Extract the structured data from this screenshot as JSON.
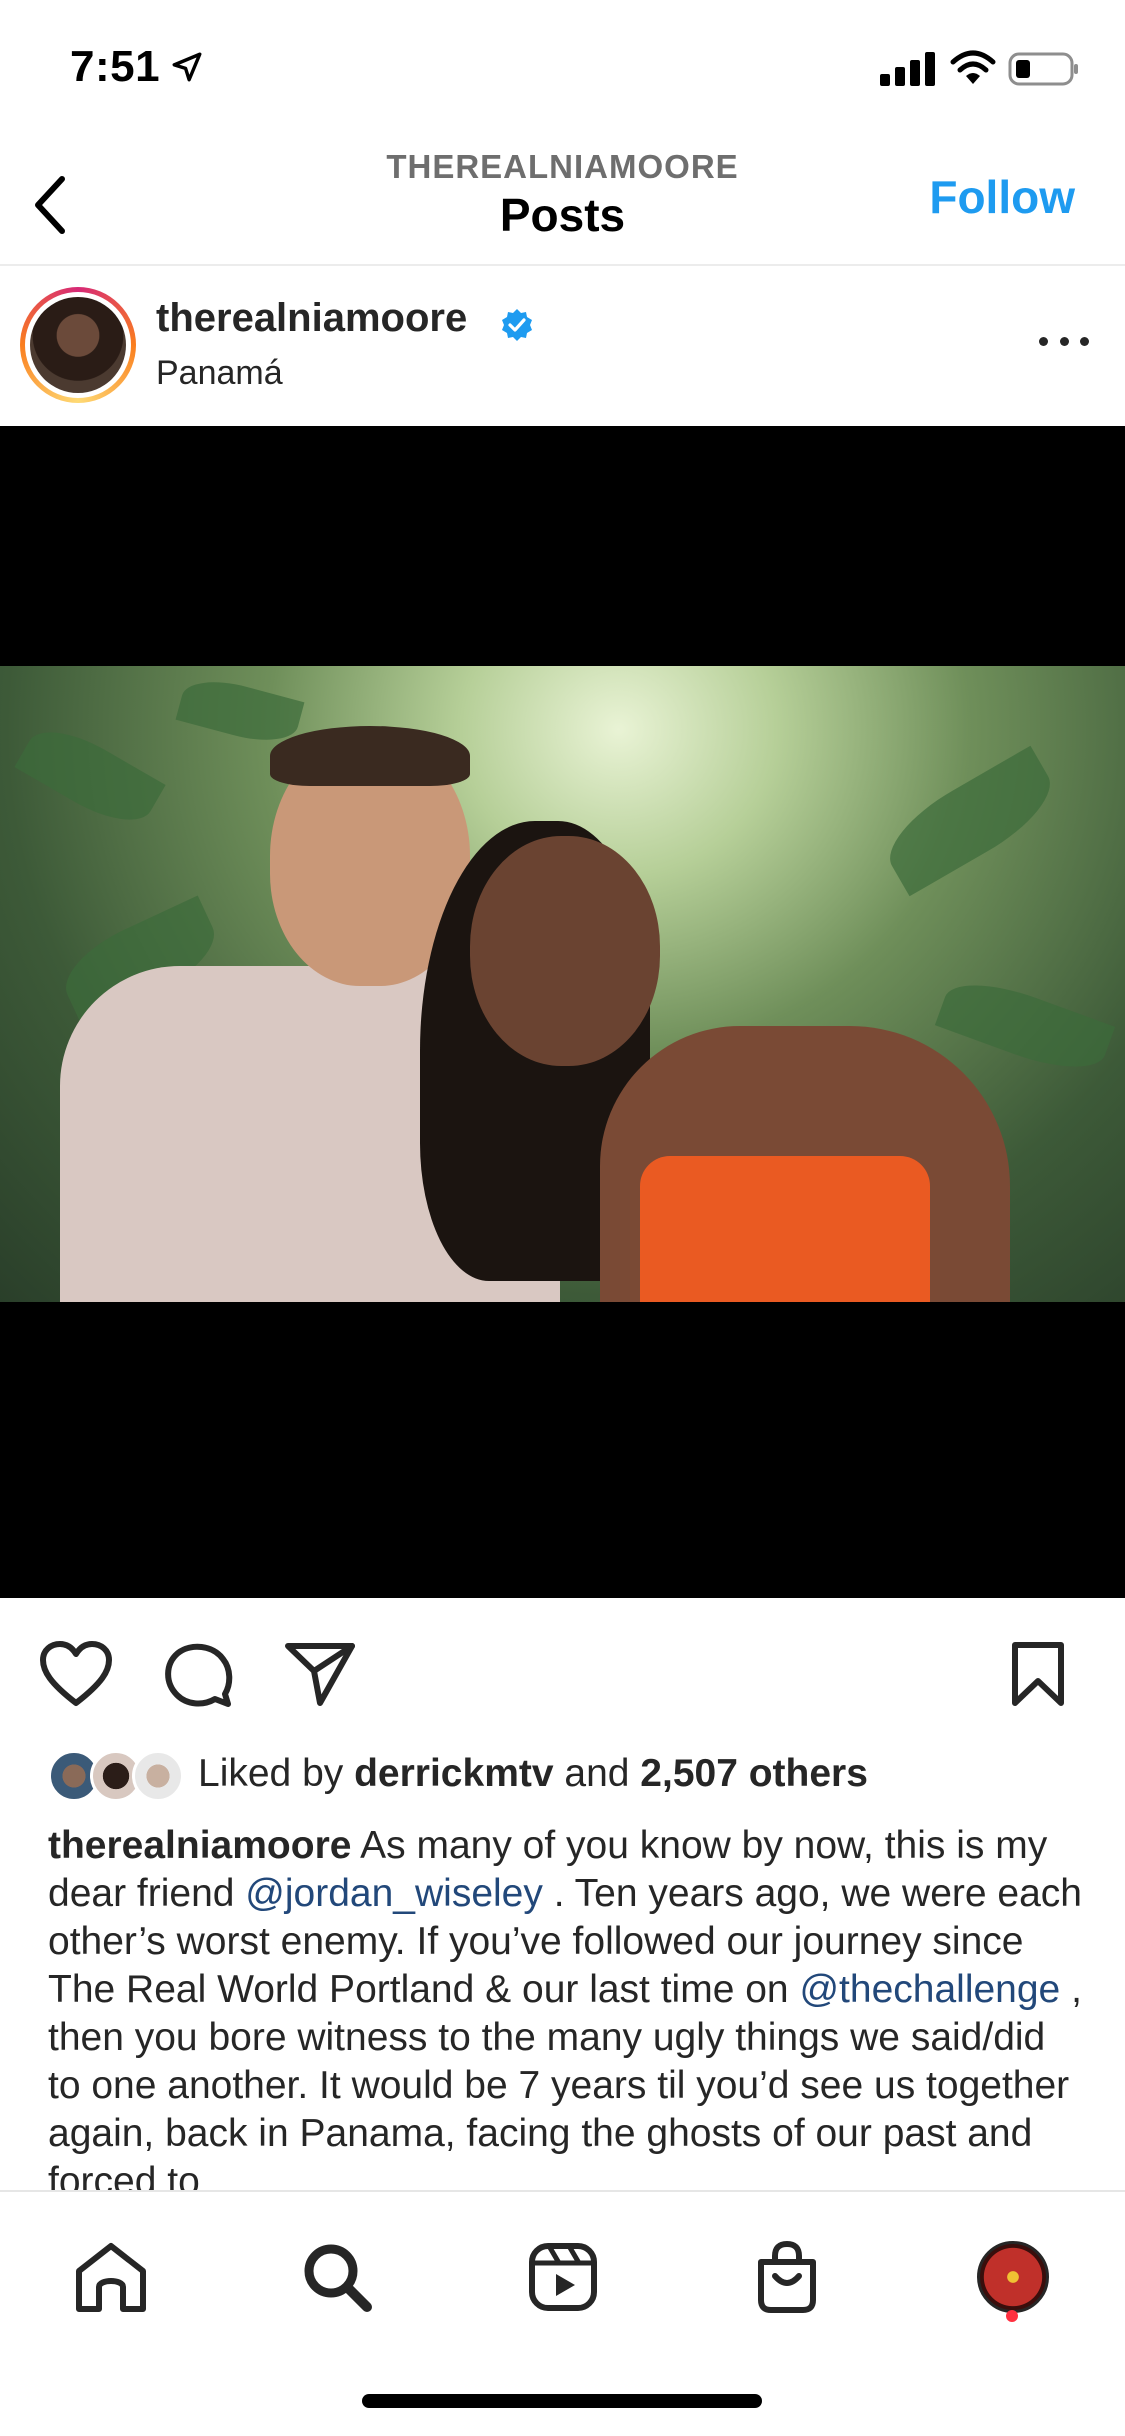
{
  "status_bar": {
    "time": "7:51"
  },
  "header": {
    "subtitle": "THEREALNIAMOORE",
    "title": "Posts",
    "follow_label": "Follow"
  },
  "post": {
    "username": "therealniamoore",
    "location": "Panamá",
    "liked_prefix": "Liked by ",
    "liked_user": "derrickmtv",
    "liked_and": " and ",
    "liked_count": "2,507 others",
    "caption": {
      "username": "therealniamoore",
      "text_1": " As many of you know by now, this is my dear friend ",
      "mention_1": "@jordan_wiseley",
      "text_2": " . Ten years ago, we were each other’s worst enemy. If you’ve followed our journey since The Real World Portland & our last time on ",
      "mention_2": "@thechallenge",
      "text_3": " , then you bore witness to the many ugly things we said/did to one another. It would be 7 years til you’d see us together again, back in Panama, facing the ghosts of our past and forced to"
    }
  },
  "colors": {
    "accent": "#1e9bf0",
    "mention": "#22487a",
    "notification": "#ff3040"
  },
  "icons": {
    "back": "chevron-left-icon",
    "verified": "verified-badge-icon",
    "more": "more-horizontal-icon",
    "like": "heart-icon",
    "comment": "comment-bubble-icon",
    "share": "paper-plane-icon",
    "save": "bookmark-icon",
    "tabs": [
      "home-icon",
      "search-icon",
      "reels-icon",
      "shop-icon",
      "profile-avatar"
    ]
  }
}
